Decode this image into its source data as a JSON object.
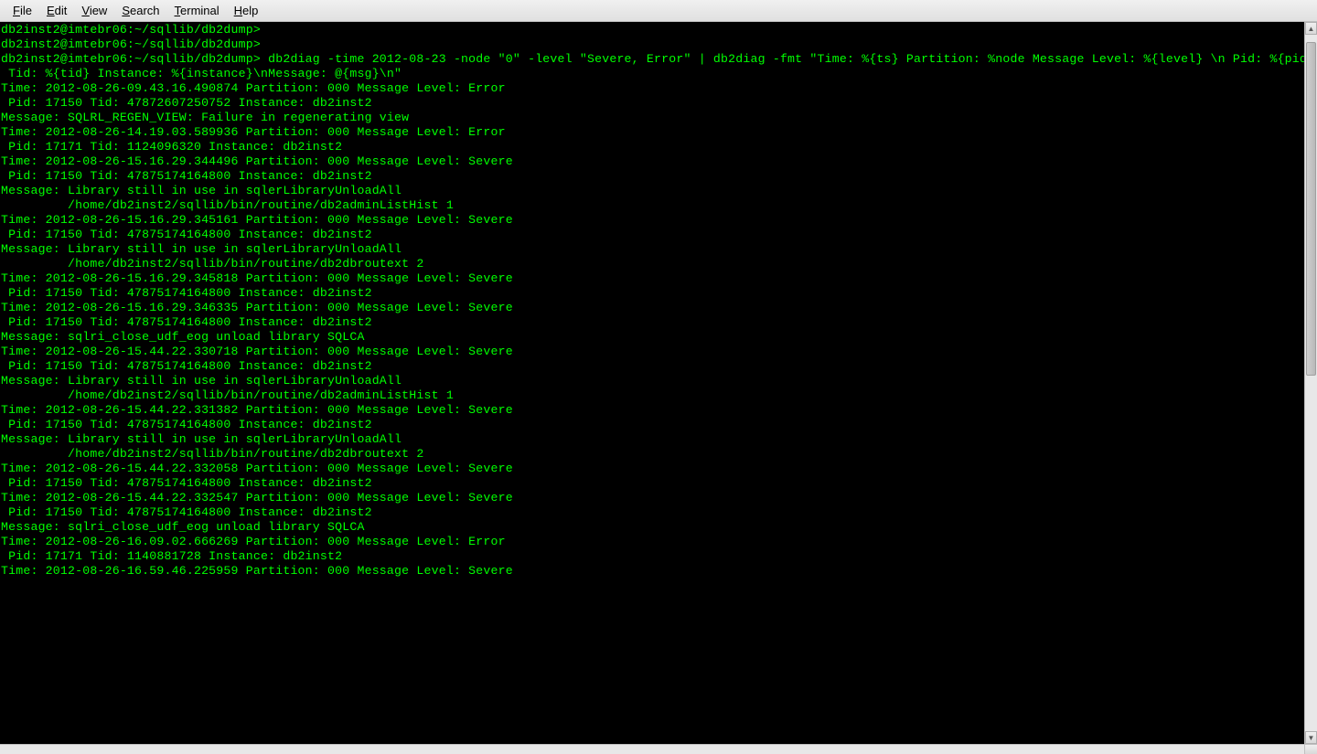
{
  "menubar": {
    "items": [
      {
        "label": "File",
        "accel": "F"
      },
      {
        "label": "Edit",
        "accel": "E"
      },
      {
        "label": "View",
        "accel": "V"
      },
      {
        "label": "Search",
        "accel": "S"
      },
      {
        "label": "Terminal",
        "accel": "T"
      },
      {
        "label": "Help",
        "accel": "H"
      }
    ]
  },
  "terminal": {
    "lines": [
      "db2inst2@imtebr06:~/sqllib/db2dump>",
      "db2inst2@imtebr06:~/sqllib/db2dump>",
      "db2inst2@imtebr06:~/sqllib/db2dump> db2diag -time 2012-08-23 -node \"0\" -level \"Severe, Error\" | db2diag -fmt \"Time: %{ts} Partition: %node Message Level: %{level} \\n Pid: %{pid}",
      " Tid: %{tid} Instance: %{instance}\\nMessage: @{msg}\\n\"",
      "Time: 2012-08-26-09.43.16.490874 Partition: 000 Message Level: Error",
      " Pid: 17150 Tid: 47872607250752 Instance: db2inst2",
      "Message: SQLRL_REGEN_VIEW: Failure in regenerating view",
      "",
      "Time: 2012-08-26-14.19.03.589936 Partition: 000 Message Level: Error",
      " Pid: 17171 Tid: 1124096320 Instance: db2inst2",
      "",
      "Time: 2012-08-26-15.16.29.344496 Partition: 000 Message Level: Severe",
      " Pid: 17150 Tid: 47875174164800 Instance: db2inst2",
      "Message: Library still in use in sqlerLibraryUnloadAll",
      "         /home/db2inst2/sqllib/bin/routine/db2adminListHist 1",
      "",
      "Time: 2012-08-26-15.16.29.345161 Partition: 000 Message Level: Severe",
      " Pid: 17150 Tid: 47875174164800 Instance: db2inst2",
      "Message: Library still in use in sqlerLibraryUnloadAll",
      "         /home/db2inst2/sqllib/bin/routine/db2dbroutext 2",
      "",
      "Time: 2012-08-26-15.16.29.345818 Partition: 000 Message Level: Severe",
      " Pid: 17150 Tid: 47875174164800 Instance: db2inst2",
      "",
      "Time: 2012-08-26-15.16.29.346335 Partition: 000 Message Level: Severe",
      " Pid: 17150 Tid: 47875174164800 Instance: db2inst2",
      "Message: sqlri_close_udf_eog unload library SQLCA",
      "",
      "Time: 2012-08-26-15.44.22.330718 Partition: 000 Message Level: Severe",
      " Pid: 17150 Tid: 47875174164800 Instance: db2inst2",
      "Message: Library still in use in sqlerLibraryUnloadAll",
      "         /home/db2inst2/sqllib/bin/routine/db2adminListHist 1",
      "",
      "Time: 2012-08-26-15.44.22.331382 Partition: 000 Message Level: Severe",
      " Pid: 17150 Tid: 47875174164800 Instance: db2inst2",
      "Message: Library still in use in sqlerLibraryUnloadAll",
      "         /home/db2inst2/sqllib/bin/routine/db2dbroutext 2",
      "",
      "Time: 2012-08-26-15.44.22.332058 Partition: 000 Message Level: Severe",
      " Pid: 17150 Tid: 47875174164800 Instance: db2inst2",
      "",
      "Time: 2012-08-26-15.44.22.332547 Partition: 000 Message Level: Severe",
      " Pid: 17150 Tid: 47875174164800 Instance: db2inst2",
      "Message: sqlri_close_udf_eog unload library SQLCA",
      "",
      "Time: 2012-08-26-16.09.02.666269 Partition: 000 Message Level: Error",
      " Pid: 17171 Tid: 1140881728 Instance: db2inst2",
      "",
      "Time: 2012-08-26-16.59.46.225959 Partition: 000 Message Level: Severe"
    ]
  },
  "scrollbar": {
    "thumb_top_pct": 1,
    "thumb_height_pct": 48
  }
}
